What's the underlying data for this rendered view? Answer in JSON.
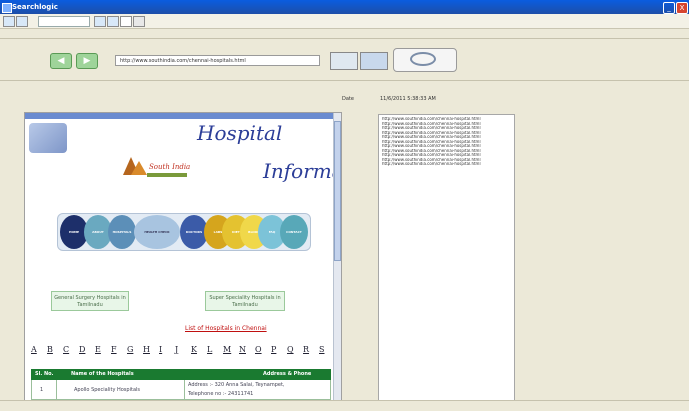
{
  "window": {
    "title": "Searchlogic",
    "min_label": "_",
    "close_label": "X"
  },
  "nav": {
    "back_label": "◀",
    "forward_label": "▶",
    "url": "http://www.southindia.com/chennai-hospitals.html"
  },
  "date": {
    "label": "Date",
    "value": "11/6/2011 5:38:33 AM"
  },
  "page": {
    "hospital_title": "Hospital",
    "info_title": "Informat",
    "logo_text": "South India",
    "menu_items": [
      "HOME",
      "ABOUT",
      "HOSPITALS",
      "HEALTH CHECK",
      "DOCTORS",
      "LABS",
      "DIET",
      "BLOOD",
      "FAQ",
      "CONTACT"
    ],
    "general_surgery_link": "General Surgery Hospitals in Tamilnadu",
    "super_speciality_link": "Super Speciality Hospitals in Tamilnadu",
    "list_link": "List of Hospitals in Chennai",
    "alphabet": [
      "A",
      "B",
      "C",
      "D",
      "E",
      "F",
      "G",
      "H",
      "I",
      "J",
      "K",
      "L",
      "M",
      "N",
      "O",
      "P",
      "Q",
      "R",
      "S"
    ],
    "table": {
      "headers": [
        "Sl. No.",
        "Name of the Hospitals",
        "Address & Phone"
      ],
      "rows": [
        {
          "no": "1",
          "name": "Apollo Speciality Hospitals",
          "address": "Address :- 320 Anna Salai, Teynampet,",
          "phone": "Telephone no :- 24311741"
        }
      ]
    }
  },
  "results": [
    "http://www.southindia.com/chennai-hospital.html",
    "http://www.southindia.com/chennai-hospital.html",
    "http://www.southindia.com/chennai-hospital.html",
    "http://www.southindia.com/chennai-hospital.html",
    "http://www.southindia.com/chennai-hospital.html",
    "http://www.southindia.com/chennai-hospital.html",
    "http://www.southindia.com/chennai-hospital.html",
    "http://www.southindia.com/chennai-hospital.html",
    "http://www.southindia.com/chennai-hospital.html",
    "http://www.southindia.com/chennai-hospital.html",
    "http://www.southindia.com/chennai-hospital.html"
  ]
}
